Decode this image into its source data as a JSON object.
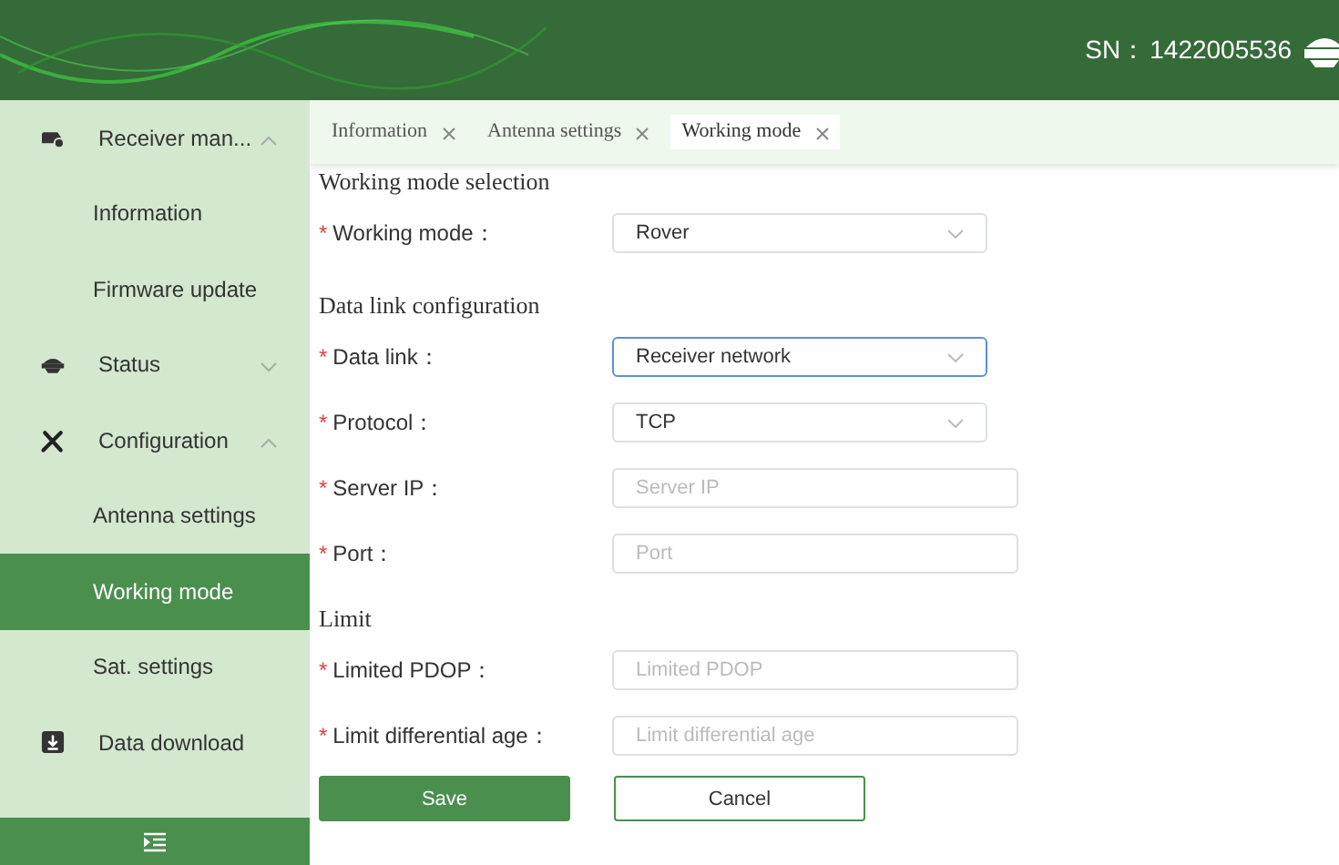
{
  "header": {
    "serial_label": "SN：",
    "serial_number": "1422005536"
  },
  "sidebar": {
    "items": [
      {
        "kind": "group",
        "label": "Receiver man...",
        "expanded": true,
        "children": [
          {
            "label": "Information",
            "selected": false
          },
          {
            "label": "Firmware update",
            "selected": false
          }
        ]
      },
      {
        "kind": "group",
        "label": "Status",
        "expanded": false
      },
      {
        "kind": "group",
        "label": "Configuration",
        "expanded": true,
        "children": [
          {
            "label": "Antenna settings",
            "selected": false
          },
          {
            "label": "Working mode",
            "selected": true
          },
          {
            "label": "Sat. settings",
            "selected": false
          }
        ]
      },
      {
        "kind": "link",
        "label": "Data download"
      }
    ]
  },
  "tabs": [
    {
      "label": "Information",
      "selected": false
    },
    {
      "label": "Antenna settings",
      "selected": false
    },
    {
      "label": "Working mode",
      "selected": true
    }
  ],
  "sections": [
    {
      "title": "Working mode selection",
      "fields": [
        {
          "mark": "*",
          "label": "Working mode：",
          "kind": "select",
          "value": "Rover",
          "focused": false
        }
      ]
    },
    {
      "title": "Data link configuration",
      "fields": [
        {
          "mark": "*",
          "label": "Data link：",
          "kind": "select",
          "value": "Receiver network",
          "focused": true
        },
        {
          "mark": "*",
          "label": "Protocol：",
          "kind": "select",
          "value": "TCP",
          "focused": false
        },
        {
          "mark": "*",
          "label": "Server IP：",
          "kind": "text",
          "placeholder": "Server IP",
          "focused": false
        },
        {
          "mark": "*",
          "label": "Port：",
          "kind": "text",
          "placeholder": "Port",
          "focused": false
        }
      ]
    },
    {
      "title": "Limit",
      "fields": [
        {
          "mark": "*",
          "label": "Limited PDOP：",
          "kind": "text",
          "placeholder": "Limited PDOP",
          "focused": false
        },
        {
          "mark": "*",
          "label": "Limit differential age：",
          "kind": "text",
          "placeholder": "Limit differential age",
          "focused": false
        }
      ]
    }
  ],
  "buttons": [
    {
      "label": "Save",
      "kind": "primary"
    },
    {
      "label": "Cancel",
      "kind": "secondary"
    }
  ]
}
